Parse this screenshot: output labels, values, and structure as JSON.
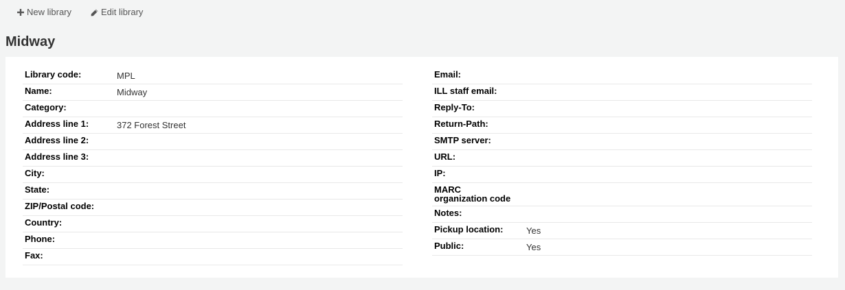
{
  "toolbar": {
    "new_library_label": "New library",
    "edit_library_label": "Edit library"
  },
  "page": {
    "title": "Midway"
  },
  "left_fields": [
    {
      "label": "Library code:",
      "value": "MPL"
    },
    {
      "label": "Name:",
      "value": "Midway"
    },
    {
      "label": "Category:",
      "value": ""
    },
    {
      "label": "Address line 1:",
      "value": "372 Forest Street"
    },
    {
      "label": "Address line 2:",
      "value": ""
    },
    {
      "label": "Address line 3:",
      "value": ""
    },
    {
      "label": "City:",
      "value": ""
    },
    {
      "label": "State:",
      "value": ""
    },
    {
      "label": "ZIP/Postal code:",
      "value": ""
    },
    {
      "label": "Country:",
      "value": ""
    },
    {
      "label": "Phone:",
      "value": ""
    },
    {
      "label": "Fax:",
      "value": ""
    }
  ],
  "right_fields": [
    {
      "label": "Email:",
      "value": ""
    },
    {
      "label": "ILL staff email:",
      "value": ""
    },
    {
      "label": "Reply-To:",
      "value": ""
    },
    {
      "label": "Return-Path:",
      "value": ""
    },
    {
      "label": "SMTP server:",
      "value": ""
    },
    {
      "label": "URL:",
      "value": ""
    },
    {
      "label": "IP:",
      "value": ""
    },
    {
      "label": "MARC\norganization code",
      "value": ""
    },
    {
      "label": "Notes:",
      "value": ""
    },
    {
      "label": "Pickup location:",
      "value": "Yes"
    },
    {
      "label": "Public:",
      "value": "Yes"
    }
  ]
}
